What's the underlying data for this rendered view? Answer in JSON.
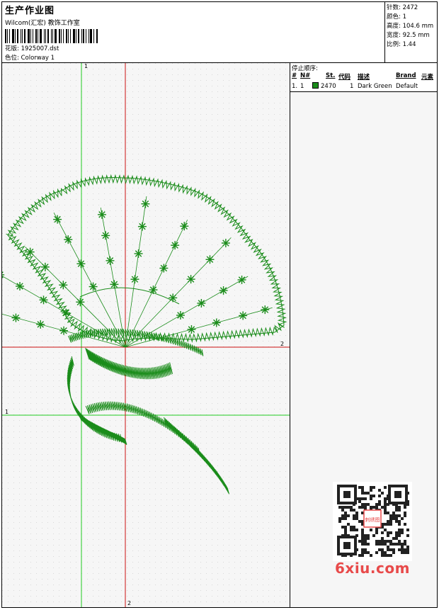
{
  "header": {
    "title": "生产作业图",
    "company": "Wilcom(汇宏) 教饰工作室",
    "design_label": "花版:",
    "design_value": "1925007.dst",
    "colorway_label": "色位:",
    "colorway_value": "Colorway 1"
  },
  "stats": {
    "stitches": "针数: 2472",
    "colors": "颜色: 1",
    "height": "高度: 104.6 mm",
    "width": "宽度: 92.5 mm",
    "ratio": "比例: 1.44"
  },
  "stop_sequence": {
    "title": "停止顺序:",
    "headers": [
      "#",
      "N#",
      "St.",
      "代码",
      "描述",
      "Brand",
      "元素"
    ],
    "rows": [
      {
        "index": "1.",
        "n": "1",
        "stitches": "2470",
        "code": "1",
        "description": "Dark Green",
        "brand": "Default",
        "color": "#1a8c1a"
      }
    ]
  },
  "axes": {
    "green_top": "1",
    "green_left": "1",
    "red_right": "2",
    "red_bottom": "2"
  },
  "colors": {
    "thread": "#1a8c1a",
    "axis_green": "#22cc22",
    "axis_red": "#cc1111",
    "brand": "#e84a4a"
  },
  "watermark": {
    "qr_stamp": "刺绣图",
    "brand_text": "6xiu.com"
  }
}
